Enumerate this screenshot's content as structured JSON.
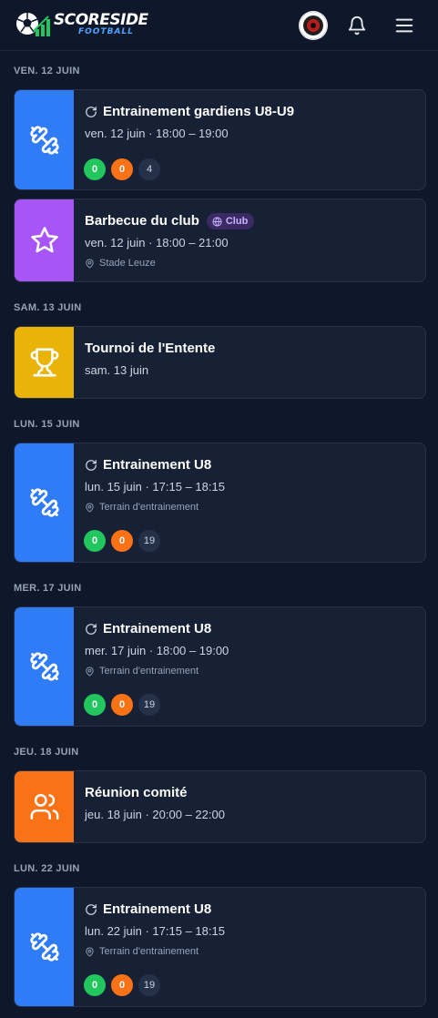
{
  "app": {
    "logo_text": "SCORESIDE",
    "logo_sub": "FOOTBALL"
  },
  "header_icons": [
    "avatar",
    "bell-icon",
    "menu-icon"
  ],
  "colors": {
    "training": "#2f7cf6",
    "event": "#a855f7",
    "tournament": "#eab308",
    "meeting": "#f97316",
    "present": "#22c55e",
    "absent": "#f97316"
  },
  "days": [
    {
      "label": "VEN. 12 JUIN"
    },
    {
      "label": "SAM. 13 JUIN"
    },
    {
      "label": "LUN. 15 JUIN"
    },
    {
      "label": "MER. 17 JUIN"
    },
    {
      "label": "JEU. 18 JUIN"
    },
    {
      "label": "LUN. 22 JUIN"
    }
  ],
  "events": [
    {
      "type": "training",
      "icon": "dumbbell-icon",
      "title": "Entrainement gardiens U8-U9",
      "recurring": true,
      "date": "ven. 12 juin · 18:00 – 19:00",
      "present": "0",
      "absent": "0",
      "pending": "4"
    },
    {
      "type": "event",
      "icon": "star-icon",
      "title": "Barbecue du club",
      "tag": "Club",
      "date": "ven. 12 juin · 18:00 – 21:00",
      "location": "Stade Leuze"
    },
    {
      "type": "tournament",
      "icon": "trophy-icon",
      "title": "Tournoi de l'Entente",
      "date": "sam. 13 juin"
    },
    {
      "type": "training",
      "icon": "dumbbell-icon",
      "title": "Entrainement U8",
      "recurring": true,
      "date": "lun. 15 juin · 17:15 – 18:15",
      "location": "Terrain d'entrainement",
      "present": "0",
      "absent": "0",
      "pending": "19"
    },
    {
      "type": "training",
      "icon": "dumbbell-icon",
      "title": "Entrainement U8",
      "recurring": true,
      "date": "mer. 17 juin · 18:00 – 19:00",
      "location": "Terrain d'entrainement",
      "present": "0",
      "absent": "0",
      "pending": "19"
    },
    {
      "type": "meeting",
      "icon": "users-icon",
      "title": "Réunion comité",
      "date": "jeu. 18 juin · 20:00 – 22:00"
    },
    {
      "type": "training",
      "icon": "dumbbell-icon",
      "title": "Entrainement U8",
      "recurring": true,
      "date": "lun. 22 juin · 17:15 – 18:15",
      "location": "Terrain d'entrainement",
      "present": "0",
      "absent": "0",
      "pending": "19"
    }
  ]
}
